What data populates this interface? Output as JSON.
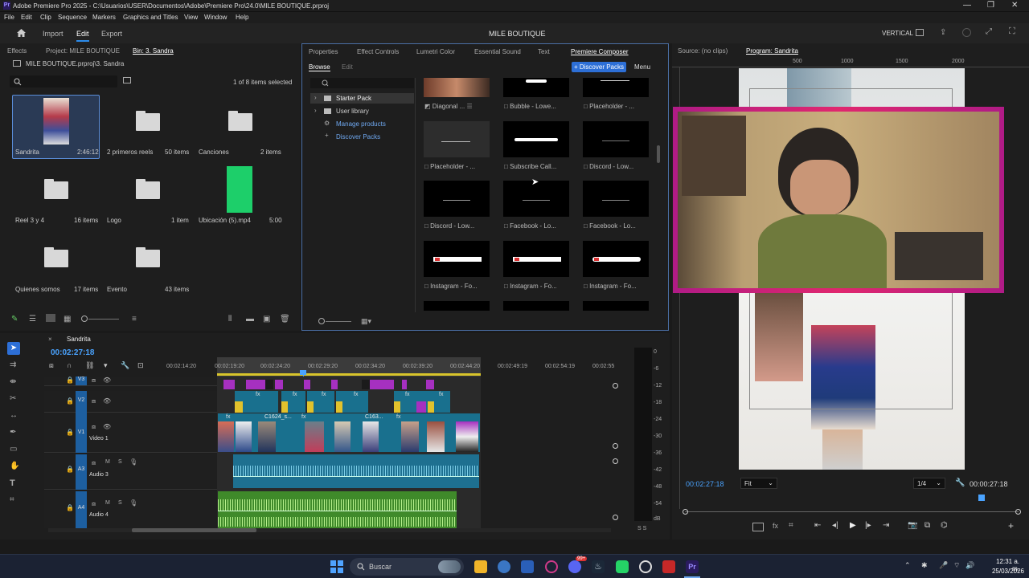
{
  "window": {
    "title": "Adobe Premiere Pro 2025 - C:\\Usuarios\\USER\\Documentos\\Adobe\\Premiere Pro\\24.0\\MILE BOUTIQUE.prproj"
  },
  "menu": [
    "File",
    "Edit",
    "Clip",
    "Sequence",
    "Markers",
    "Graphics and Titles",
    "View",
    "Window",
    "Help"
  ],
  "header": {
    "nav": [
      "Import",
      "Edit",
      "Export"
    ],
    "active": "Edit",
    "project_title": "MILE BOUTIQUE",
    "workspace": "VERTICAL"
  },
  "project_panel": {
    "tabs": [
      "Effects",
      "Project: MILE BOUTIQUE",
      "Bin: 3. Sandra"
    ],
    "path": "MILE BOUTIQUE.prproj\\3. Sandra",
    "selection": "1 of 8 items selected",
    "items": [
      {
        "name": "Sandrita",
        "info": "2:46:12"
      },
      {
        "name": "2 primeros reels",
        "info": "50 items"
      },
      {
        "name": "Canciones",
        "info": "2 items"
      },
      {
        "name": "Reel 3 y 4",
        "info": "16 items"
      },
      {
        "name": "Logo",
        "info": "1 item"
      },
      {
        "name": "Ubicación (5).mp4",
        "info": "5:00"
      },
      {
        "name": "Quienes somos",
        "info": "17 items"
      },
      {
        "name": "Evento",
        "info": "43 items"
      }
    ]
  },
  "composer": {
    "tabs": [
      "Properties",
      "Effect Controls",
      "Lumetri Color",
      "Essential Sound",
      "Text",
      "Premiere Composer"
    ],
    "subtabs": [
      "Browse",
      "Edit"
    ],
    "discover_button": "+ Discover Packs",
    "menu_label": "Menu",
    "tree": [
      "Starter Pack",
      "User library",
      "Manage products",
      "Discover Packs"
    ],
    "tiles": [
      "Diagonal ...",
      "Bubble - Lowe...",
      "Placeholder - ...",
      "Placeholder - ...",
      "Subscribe Call...",
      "Discord - Low...",
      "Discord - Low...",
      "Facebook - Lo...",
      "Facebook - Lo...",
      "Instagram - Fo...",
      "Instagram - Fo...",
      "Instagram - Fo..."
    ]
  },
  "program": {
    "tabs": [
      "Source: (no clips)",
      "Program: Sandrita"
    ],
    "ruler": [
      "500",
      "1000",
      "1500",
      "2000"
    ],
    "timecode_left": "00:02:27:18",
    "fit": "Fit",
    "quality": "1/4",
    "timecode_right": "00:00:27:18"
  },
  "timeline": {
    "sequence": "Sandrita",
    "timecode": "00:02:27:18",
    "ruler": [
      "00:02:14:20",
      "00:02:19:20",
      "00:02:24:20",
      "00:02:29:20",
      "00:02:34:20",
      "00:02:39:20",
      "00:02:44:20",
      "00:02:49:19",
      "00:02:54:19",
      "00:02:55"
    ],
    "tracks": [
      {
        "id": "V3",
        "name": ""
      },
      {
        "id": "V2",
        "name": ""
      },
      {
        "id": "V1",
        "name": "Video 1"
      },
      {
        "id": "A3",
        "name": "Audio 3"
      },
      {
        "id": "A4",
        "name": "Audio 4"
      }
    ],
    "clip_labels": [
      "C1624_s...",
      "C163..."
    ],
    "meter_scale": [
      "0",
      "-6",
      "-12",
      "-18",
      "-24",
      "-30",
      "-36",
      "-42",
      "-48",
      "-54",
      "dB"
    ],
    "meter_bottom": "S S"
  },
  "taskbar": {
    "search": "Buscar",
    "time": "12:31 a. m.",
    "date": "25/03/2026",
    "badge": "99+"
  },
  "colors": {
    "accent": "#2d8ceb",
    "border_frame": "#d0207a",
    "video_track": "#19708e",
    "audio_track": "#3f8a2a"
  }
}
